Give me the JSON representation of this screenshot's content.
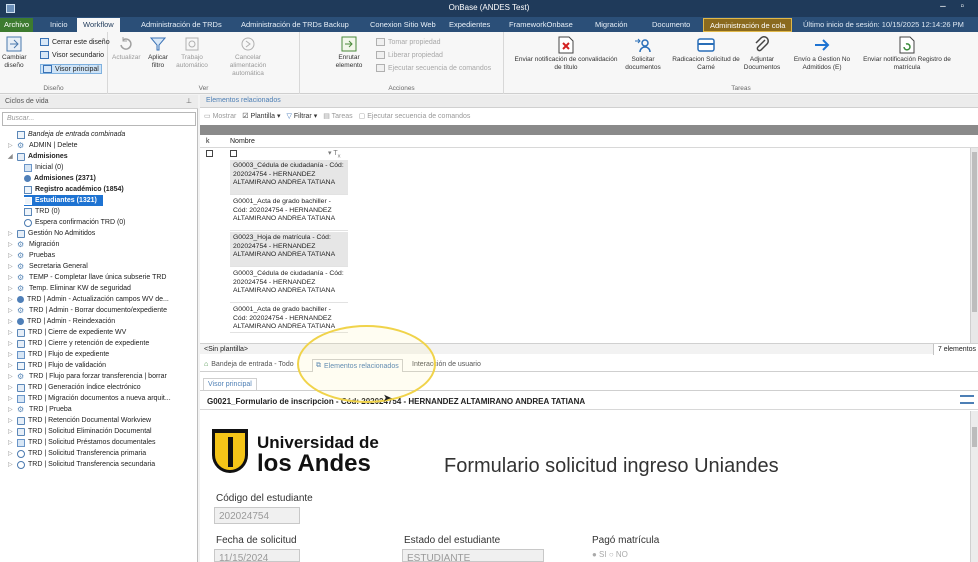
{
  "window": {
    "title": "OnBase (ANDES Test)"
  },
  "tabs": {
    "archivo": "Archivo",
    "inicio": "Inicio",
    "workflow": "Workflow",
    "admin_trds": "Administración de TRDs",
    "admin_trds_backup": "Administración de TRDs Backup",
    "conexion": "Conexion Sitio Web",
    "expedientes": "Expedientes",
    "framework": "FrameworkOnbase",
    "migracion": "Migración",
    "documento": "Documento",
    "admin_cola": "Administración de cola",
    "last_login": "Último inicio de sesión: 10/15/2025 12:14:26 PM"
  },
  "ribbon": {
    "diseno": {
      "cambiar": "Cambiar diseño",
      "cerrar": "Cerrar este diseño",
      "visor_secundario": "Visor secundario",
      "visor_principal": "Visor principal",
      "label": "Diseño"
    },
    "ver": {
      "actualizar": "Actualizar",
      "aplicar": "Aplicar filtro",
      "trabajo": "Trabajo automático",
      "cancelar": "Cancelar alimentación automática",
      "label": "Ver"
    },
    "acciones": {
      "enrutar": "Enrutar elemento",
      "tomar": "Tomar propiedad",
      "liberar": "Liberar propiedad",
      "ejecutar": "Ejecutar secuencia de comandos",
      "label": "Acciones"
    },
    "tareas": {
      "enviar_notif": "Enviar notificación de convalidación de título",
      "solicitar": "Solicitar documentos",
      "radicacion": "Radicacion Solicitud de Carné",
      "adjuntar": "Adjuntar Documentos",
      "envio": "Envío a Gestion No Admitidos (E)",
      "enviar_reg": "Enviar notificación Registro de matrícula",
      "label": "Tareas"
    }
  },
  "left_pane": {
    "title": "Ciclos de vida",
    "search_placeholder": "Buscar...",
    "tree": [
      "Bandeja de entrada combinada",
      "ADMIN | Delete",
      "Admisiones",
      "Inicial (0)",
      "Admisiones (2371)",
      "Registro académico (1854)",
      "Estudiantes (1321)",
      "TRD (0)",
      "Espera confirmación TRD (0)",
      "Gestión No Admitidos",
      "Migración",
      "Pruebas",
      "Secretaria General",
      "TEMP - Completar llave única subserie TRD",
      "Temp. Eliminar KW de seguridad",
      "TRD | Admin - Actualización campos WV de...",
      "TRD | Admin - Borrar documento/expediente",
      "TRD | Admin - Reindexación",
      "TRD | Cierre de expediente WV",
      "TRD | Cierre y retención de expediente",
      "TRD | Flujo de expediente",
      "TRD | Flujo de validación",
      "TRD | Flujo para forzar transferencia | borrar",
      "TRD | Generación índice electrónico",
      "TRD | Migración documentos a nueva arquit...",
      "TRD | Prueba",
      "TRD | Retención Documental Workview",
      "TRD | Solicitud Eliminación Documental",
      "TRD | Solicitud Préstamos documentales",
      "TRD | Solicitud Transferencia primaria",
      "TRD | Solicitud Transferencia secundaria"
    ]
  },
  "related": {
    "header": "Elementos relacionados",
    "mostrar": "Mostrar",
    "plantilla": "Plantilla",
    "filtrar": "Filtrar",
    "tareas": "Tareas",
    "ejecutar": "Ejecutar secuencia de comandos",
    "col_k": "k",
    "col_nombre": "Nombre",
    "filter_mark": "▾ T",
    "filter_x": "x",
    "documents": [
      "G0003_Cédula de ciudadanía - Cód: 202024754 - HERNANDEZ ALTAMIRANO ANDREA TATIANA",
      "G0001_Acta de grado bachiller - Cód: 202024754 - HERNANDEZ ALTAMIRANO ANDREA TATIANA",
      "G0023_Hoja de matrícula - Cód: 202024754 - HERNANDEZ ALTAMIRANO ANDREA TATIANA",
      "G0003_Cédula de ciudadanía - Cód: 202024754 - HERNANDEZ ALTAMIRANO ANDREA TATIANA",
      "G0001_Acta de grado bachiller - Cód: 202024754 - HERNANDEZ ALTAMIRANO ANDREA TATIANA"
    ],
    "template_status": "<Sin plantilla>",
    "count": "7 elementos"
  },
  "bottom_tabs": {
    "bandeja": "Bandeja de entrada - Todo",
    "elementos": "Elementos relacionados",
    "interaccion": "Interacción de usuario"
  },
  "viewer": {
    "tab": "Visor principal",
    "doc_title": "G0021_Formulario de inscripcion - Cód: 202024754 - HERNANDEZ ALTAMIRANO ANDREA TATIANA"
  },
  "form": {
    "uni_line1": "Universidad de",
    "uni_line2": "los Andes",
    "title": "Formulario solicitud ingreso Uniandes",
    "codigo_label": "Código del estudiante",
    "codigo_value": "202024754",
    "fecha_label": "Fecha de solicitud",
    "fecha_value": "11/15/2024",
    "estado_label": "Estado del estudiante",
    "estado_value": "ESTUDIANTE",
    "pago_label": "Pagó matrícula",
    "pago_options": "● SI ○ NO"
  },
  "colors": {
    "title_bar": "#1f3a5a",
    "tab_bar": "#2b4f78",
    "selected": "#1e73d2",
    "accent": "#4d7fb5",
    "highlight_circle": "#f0d34a",
    "logo_yellow": "#f5c518"
  }
}
